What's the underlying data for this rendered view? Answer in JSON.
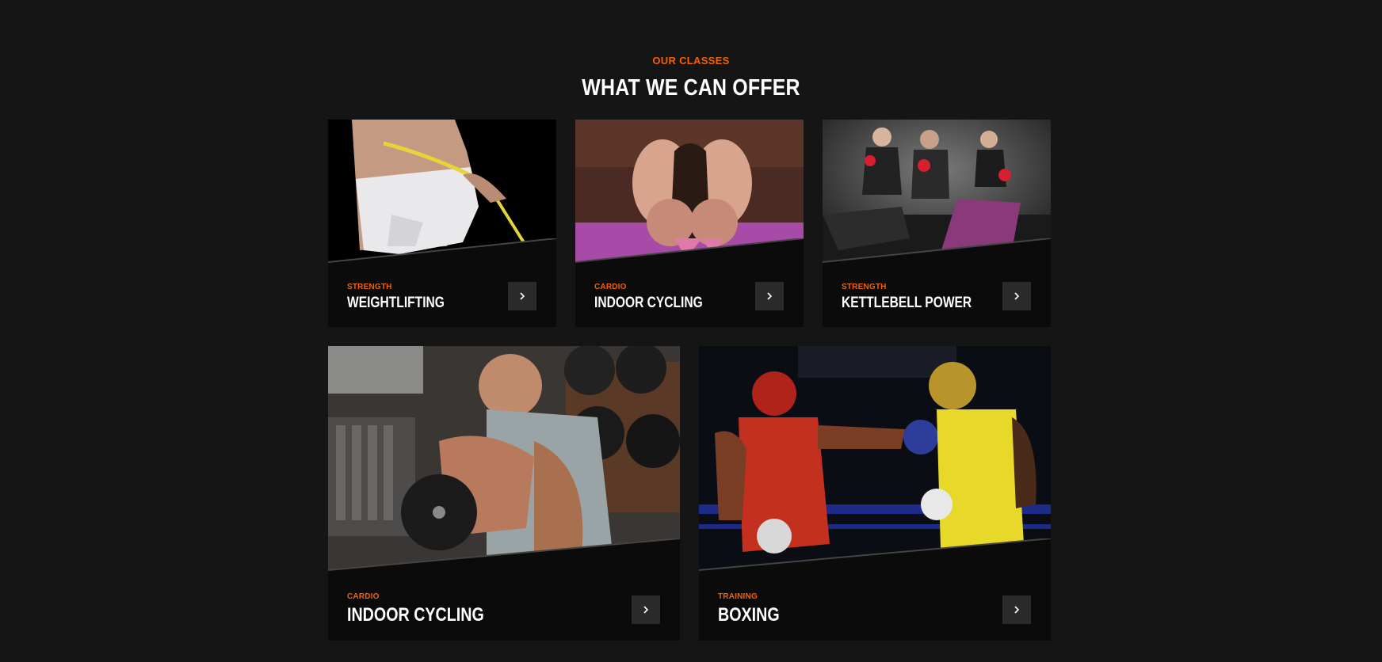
{
  "section": {
    "eyebrow": "OUR CLASSES",
    "heading": "WHAT WE CAN OFFER"
  },
  "classes": [
    {
      "category": "STRENGTH",
      "title": "WEIGHTLIFTING",
      "image": "waist-measuring-photo",
      "arrow_icon": "chevron-right-icon"
    },
    {
      "category": "CARDIO",
      "title": "INDOOR CYCLING",
      "image": "stretching-feet-photo",
      "arrow_icon": "chevron-right-icon"
    },
    {
      "category": "STRENGTH",
      "title": "KETTLEBELL POWER",
      "image": "kettlebell-group-photo",
      "arrow_icon": "chevron-right-icon"
    },
    {
      "category": "CARDIO",
      "title": "INDOOR CYCLING",
      "image": "dumbbell-curl-photo",
      "arrow_icon": "chevron-right-icon"
    },
    {
      "category": "TRAINING",
      "title": "BOXING",
      "image": "boxing-match-photo",
      "arrow_icon": "chevron-right-icon"
    }
  ],
  "colors": {
    "background": "#151515",
    "card": "#0b0b0b",
    "accent": "#f36100",
    "button": "#2b2b2b",
    "text": "#ffffff"
  }
}
